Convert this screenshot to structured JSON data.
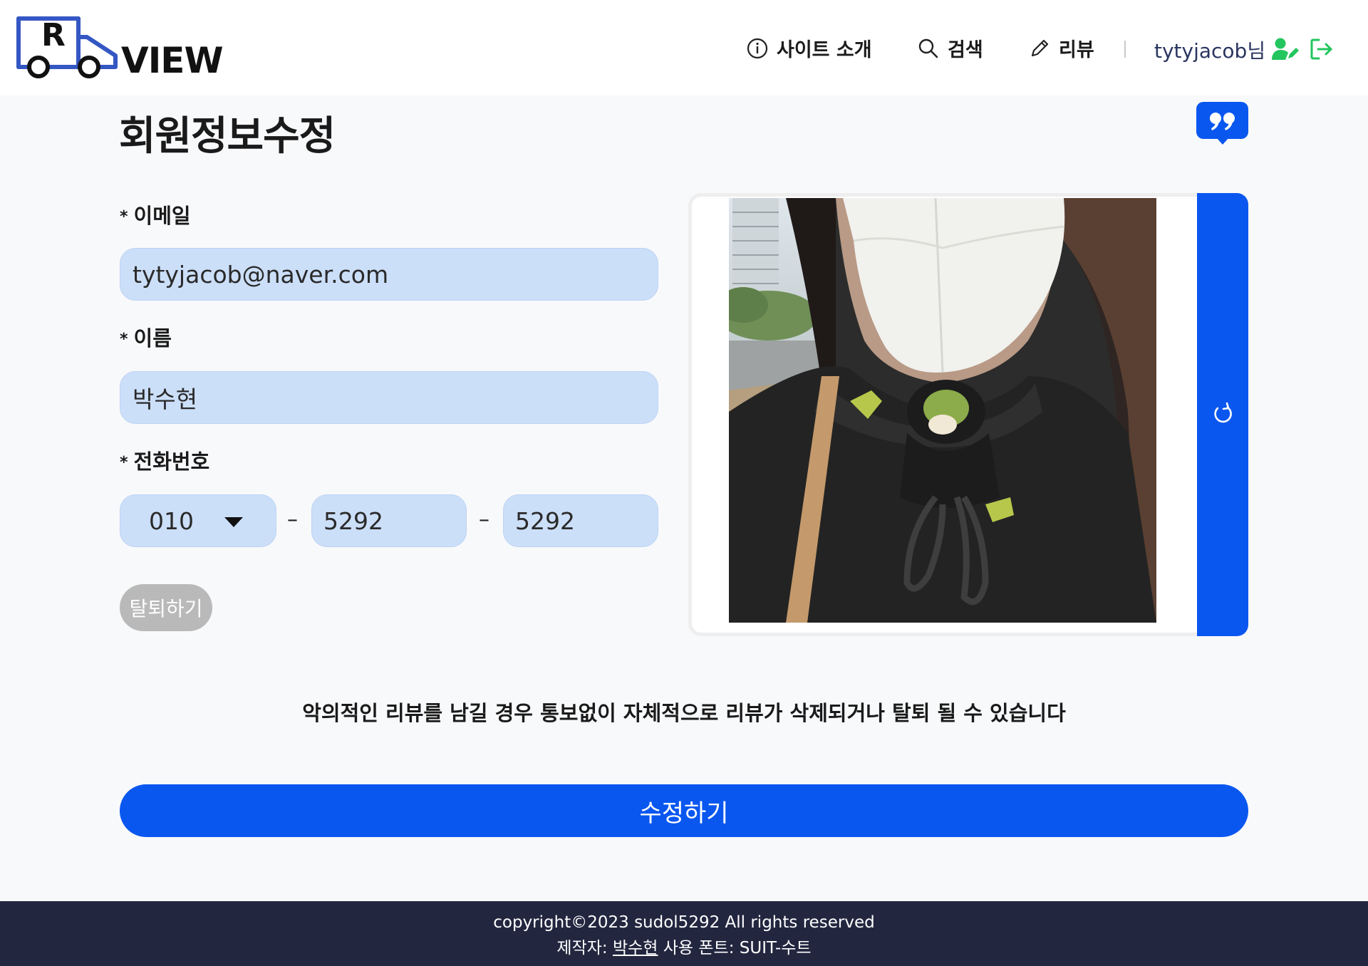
{
  "header": {
    "logo_letter": "R",
    "logo_text": "VIEW",
    "nav": {
      "about": "사이트 소개",
      "search": "검색",
      "review": "리뷰"
    },
    "user_name": "tytyjacob님"
  },
  "page": {
    "title": "회원정보수정"
  },
  "form": {
    "required_mark": "*",
    "email_label": "이메일",
    "email_value": "tytyjacob@naver.com",
    "name_label": "이름",
    "name_value": "박수현",
    "phone_label": "전화번호",
    "phone_prefix": "010",
    "phone_dash": "–",
    "phone_middle": "5292",
    "phone_last": "5292",
    "withdraw_label": "탈퇴하기"
  },
  "notice": "악의적인 리뷰를 남길 경우 통보없이 자체적으로 리뷰가 삭제되거나 탈퇴 될 수 있습니다",
  "submit_label": "수정하기",
  "footer": {
    "copyright": "copyright©2023 sudol5292 All rights reserved",
    "maker_prefix": "제작자:",
    "maker_name": "박수현",
    "font_info": "사용 폰트: SUIT-수트"
  },
  "colors": {
    "accent": "#0a57f0",
    "input_bg": "#ccdff9",
    "footer_bg": "#22263f",
    "user_icon": "#22c55e"
  },
  "icons": {
    "about": "info-icon",
    "search": "search-icon",
    "review": "pencil-icon",
    "user": "user-edit-icon",
    "logout": "logout-icon",
    "quote": "quote-icon",
    "rotate": "rotate-icon"
  }
}
